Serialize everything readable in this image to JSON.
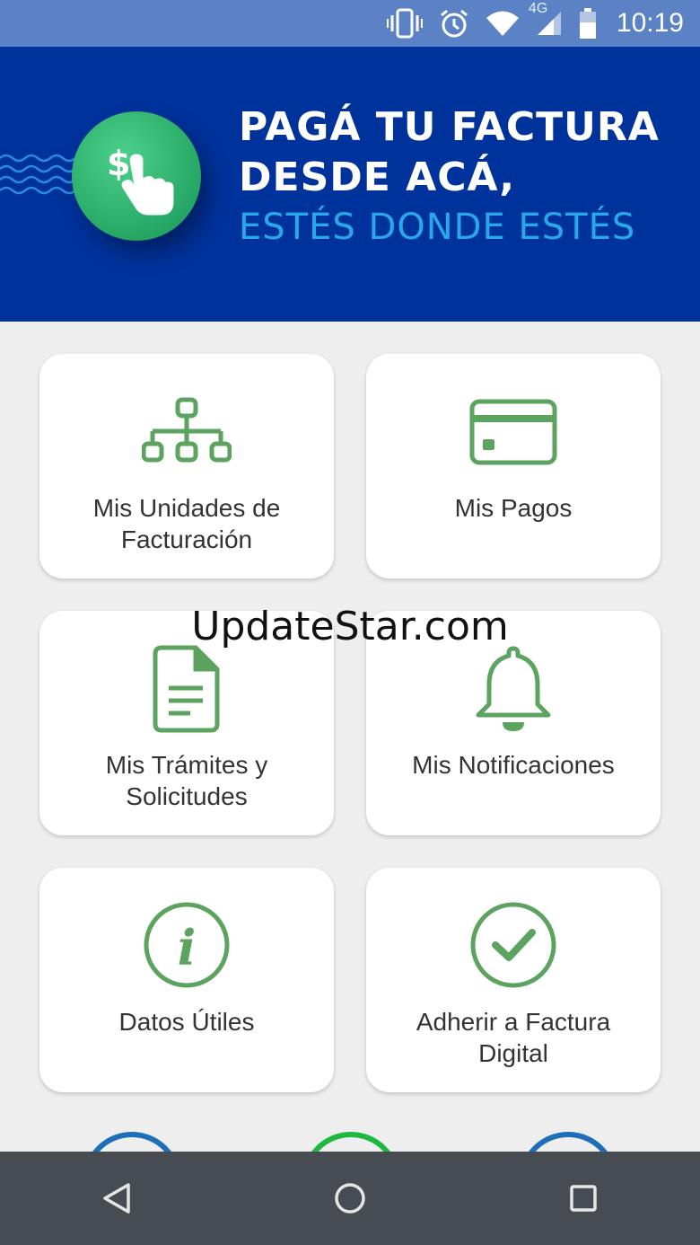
{
  "status_bar": {
    "network": "4G",
    "time": "10:19",
    "icons": [
      "vibrate-icon",
      "alarm-icon",
      "wifi-icon",
      "signal-icon",
      "battery-icon"
    ]
  },
  "banner": {
    "line1": "PAGÁ TU FACTURA",
    "line2": "DESDE ACÁ,",
    "line3": "ESTÉS DONDE ESTÉS",
    "icon": "pay-touch-icon",
    "colors": {
      "background": "#00329c",
      "accent": "#28a8e8",
      "coin": "#2fb471"
    }
  },
  "menu": [
    {
      "label_line1": "Mis Unidades de",
      "label_line2": "Facturación",
      "icon": "hierarchy-icon"
    },
    {
      "label_line1": "Mis Pagos",
      "label_line2": "",
      "icon": "credit-card-icon"
    },
    {
      "label_line1": "Mis Trámites y",
      "label_line2": "Solicitudes",
      "icon": "document-icon"
    },
    {
      "label_line1": "Mis Notificaciones",
      "label_line2": "",
      "icon": "bell-icon"
    },
    {
      "label_line1": "Datos Útiles",
      "label_line2": "",
      "icon": "info-icon"
    },
    {
      "label_line1": "Adherir a Factura",
      "label_line2": "Digital",
      "icon": "check-circle-icon"
    }
  ],
  "icon_color": "#5ba35f",
  "watermark": "UpdateStar.com",
  "nav": {
    "icons": [
      "back-icon",
      "home-icon",
      "recents-icon"
    ]
  }
}
